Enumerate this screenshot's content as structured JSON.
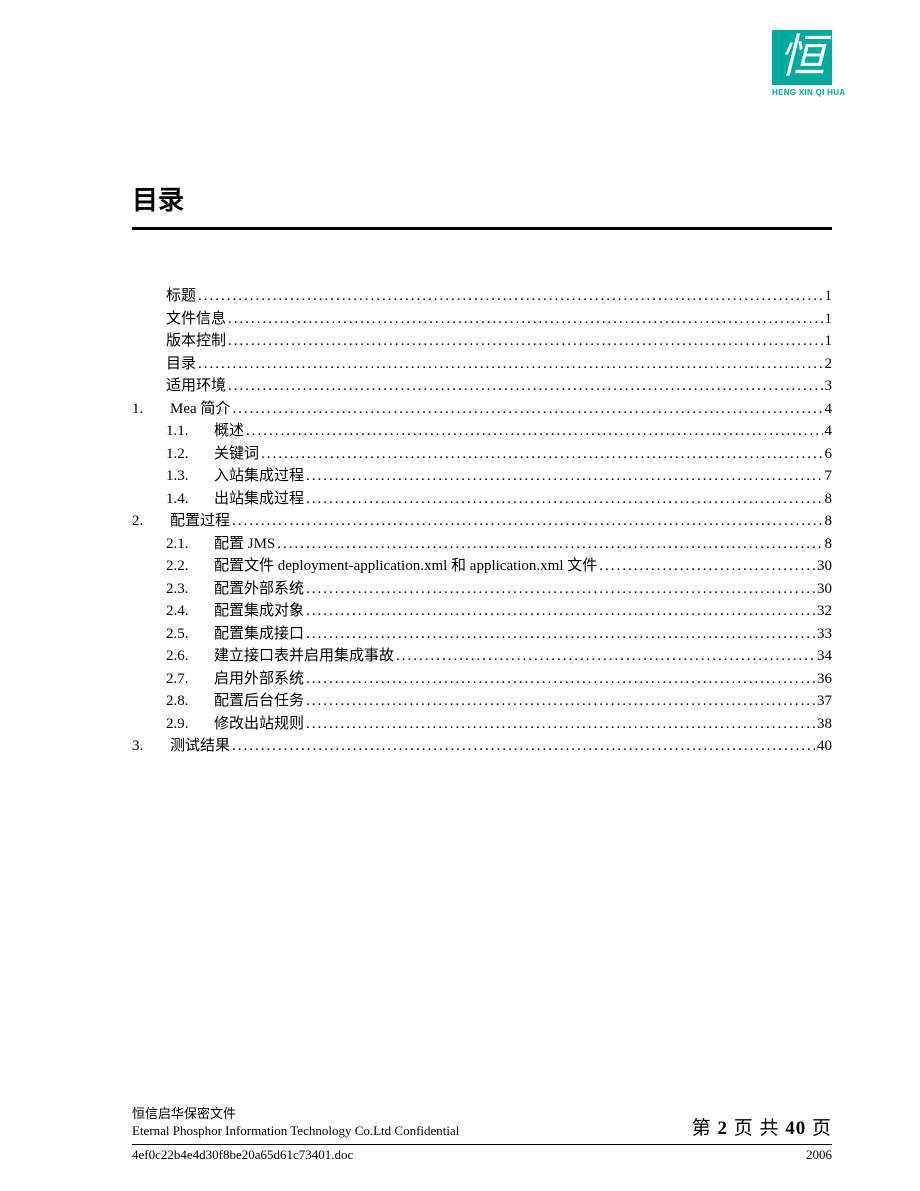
{
  "logo": {
    "glyph": "恒",
    "subtext": "HENG XIN QI HUA"
  },
  "heading": "目录",
  "toc": [
    {
      "level": 0,
      "num": "",
      "title": "标题",
      "page": "1"
    },
    {
      "level": 0,
      "num": "",
      "title": "文件信息",
      "page": "1"
    },
    {
      "level": 0,
      "num": "",
      "title": "版本控制",
      "page": "1"
    },
    {
      "level": 0,
      "num": "",
      "title": "目录",
      "page": "2"
    },
    {
      "level": 0,
      "num": "",
      "title": "适用环境",
      "page": "3"
    },
    {
      "level": 0,
      "num": "1.",
      "title": "Mea 简介",
      "page": "4"
    },
    {
      "level": 1,
      "num": "1.1.",
      "title": "概述",
      "page": "4"
    },
    {
      "level": 1,
      "num": "1.2.",
      "title": "关键词",
      "page": "6"
    },
    {
      "level": 1,
      "num": "1.3.",
      "title": "入站集成过程",
      "page": "7"
    },
    {
      "level": 1,
      "num": "1.4.",
      "title": "出站集成过程",
      "page": "8"
    },
    {
      "level": 0,
      "num": "2.",
      "title": "配置过程",
      "page": "8"
    },
    {
      "level": 1,
      "num": "2.1.",
      "title": "配置 JMS",
      "page": "8"
    },
    {
      "level": 1,
      "num": "2.2.",
      "title": "配置文件 deployment-application.xml 和 application.xml 文件",
      "page": "30"
    },
    {
      "level": 1,
      "num": "2.3.",
      "title": "配置外部系统",
      "page": "30"
    },
    {
      "level": 1,
      "num": "2.4.",
      "title": "配置集成对象",
      "page": "32"
    },
    {
      "level": 1,
      "num": "2.5.",
      "title": "配置集成接口",
      "page": "33"
    },
    {
      "level": 1,
      "num": "2.6.",
      "title": "建立接口表并启用集成事故",
      "page": "34"
    },
    {
      "level": 1,
      "num": "2.7.",
      "title": "启用外部系统",
      "page": "36"
    },
    {
      "level": 1,
      "num": "2.8.",
      "title": "配置后台任务",
      "page": "37"
    },
    {
      "level": 1,
      "num": "2.9.",
      "title": "修改出站规则",
      "page": "38"
    },
    {
      "level": 0,
      "num": "3.",
      "title": "测试结果",
      "page": "40"
    }
  ],
  "footer": {
    "confidential_zh": "恒信启华保密文件",
    "confidential_en": "Eternal Phosphor Information Technology Co.Ltd Confidential",
    "page_label_prefix": "第 ",
    "page_current": "2",
    "page_label_mid": " 页 共 ",
    "page_total": "40",
    "page_label_suffix": " 页",
    "doc_ref": "4ef0c22b4e4d30f8be20a65d61c73401.doc",
    "year": "2006"
  }
}
